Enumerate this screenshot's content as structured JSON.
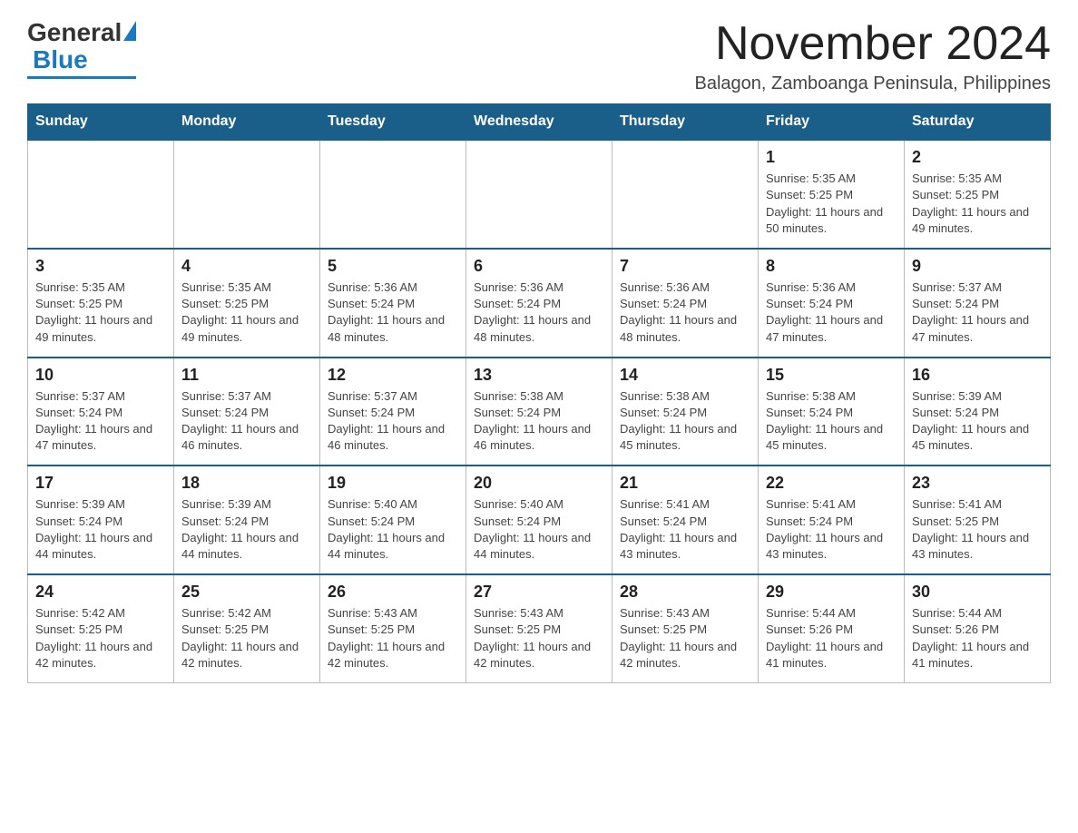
{
  "logo": {
    "general": "General",
    "blue": "Blue"
  },
  "header": {
    "month_year": "November 2024",
    "location": "Balagon, Zamboanga Peninsula, Philippines"
  },
  "days_of_week": [
    "Sunday",
    "Monday",
    "Tuesday",
    "Wednesday",
    "Thursday",
    "Friday",
    "Saturday"
  ],
  "weeks": [
    [
      {
        "day": "",
        "info": ""
      },
      {
        "day": "",
        "info": ""
      },
      {
        "day": "",
        "info": ""
      },
      {
        "day": "",
        "info": ""
      },
      {
        "day": "",
        "info": ""
      },
      {
        "day": "1",
        "info": "Sunrise: 5:35 AM\nSunset: 5:25 PM\nDaylight: 11 hours and 50 minutes."
      },
      {
        "day": "2",
        "info": "Sunrise: 5:35 AM\nSunset: 5:25 PM\nDaylight: 11 hours and 49 minutes."
      }
    ],
    [
      {
        "day": "3",
        "info": "Sunrise: 5:35 AM\nSunset: 5:25 PM\nDaylight: 11 hours and 49 minutes."
      },
      {
        "day": "4",
        "info": "Sunrise: 5:35 AM\nSunset: 5:25 PM\nDaylight: 11 hours and 49 minutes."
      },
      {
        "day": "5",
        "info": "Sunrise: 5:36 AM\nSunset: 5:24 PM\nDaylight: 11 hours and 48 minutes."
      },
      {
        "day": "6",
        "info": "Sunrise: 5:36 AM\nSunset: 5:24 PM\nDaylight: 11 hours and 48 minutes."
      },
      {
        "day": "7",
        "info": "Sunrise: 5:36 AM\nSunset: 5:24 PM\nDaylight: 11 hours and 48 minutes."
      },
      {
        "day": "8",
        "info": "Sunrise: 5:36 AM\nSunset: 5:24 PM\nDaylight: 11 hours and 47 minutes."
      },
      {
        "day": "9",
        "info": "Sunrise: 5:37 AM\nSunset: 5:24 PM\nDaylight: 11 hours and 47 minutes."
      }
    ],
    [
      {
        "day": "10",
        "info": "Sunrise: 5:37 AM\nSunset: 5:24 PM\nDaylight: 11 hours and 47 minutes."
      },
      {
        "day": "11",
        "info": "Sunrise: 5:37 AM\nSunset: 5:24 PM\nDaylight: 11 hours and 46 minutes."
      },
      {
        "day": "12",
        "info": "Sunrise: 5:37 AM\nSunset: 5:24 PM\nDaylight: 11 hours and 46 minutes."
      },
      {
        "day": "13",
        "info": "Sunrise: 5:38 AM\nSunset: 5:24 PM\nDaylight: 11 hours and 46 minutes."
      },
      {
        "day": "14",
        "info": "Sunrise: 5:38 AM\nSunset: 5:24 PM\nDaylight: 11 hours and 45 minutes."
      },
      {
        "day": "15",
        "info": "Sunrise: 5:38 AM\nSunset: 5:24 PM\nDaylight: 11 hours and 45 minutes."
      },
      {
        "day": "16",
        "info": "Sunrise: 5:39 AM\nSunset: 5:24 PM\nDaylight: 11 hours and 45 minutes."
      }
    ],
    [
      {
        "day": "17",
        "info": "Sunrise: 5:39 AM\nSunset: 5:24 PM\nDaylight: 11 hours and 44 minutes."
      },
      {
        "day": "18",
        "info": "Sunrise: 5:39 AM\nSunset: 5:24 PM\nDaylight: 11 hours and 44 minutes."
      },
      {
        "day": "19",
        "info": "Sunrise: 5:40 AM\nSunset: 5:24 PM\nDaylight: 11 hours and 44 minutes."
      },
      {
        "day": "20",
        "info": "Sunrise: 5:40 AM\nSunset: 5:24 PM\nDaylight: 11 hours and 44 minutes."
      },
      {
        "day": "21",
        "info": "Sunrise: 5:41 AM\nSunset: 5:24 PM\nDaylight: 11 hours and 43 minutes."
      },
      {
        "day": "22",
        "info": "Sunrise: 5:41 AM\nSunset: 5:24 PM\nDaylight: 11 hours and 43 minutes."
      },
      {
        "day": "23",
        "info": "Sunrise: 5:41 AM\nSunset: 5:25 PM\nDaylight: 11 hours and 43 minutes."
      }
    ],
    [
      {
        "day": "24",
        "info": "Sunrise: 5:42 AM\nSunset: 5:25 PM\nDaylight: 11 hours and 42 minutes."
      },
      {
        "day": "25",
        "info": "Sunrise: 5:42 AM\nSunset: 5:25 PM\nDaylight: 11 hours and 42 minutes."
      },
      {
        "day": "26",
        "info": "Sunrise: 5:43 AM\nSunset: 5:25 PM\nDaylight: 11 hours and 42 minutes."
      },
      {
        "day": "27",
        "info": "Sunrise: 5:43 AM\nSunset: 5:25 PM\nDaylight: 11 hours and 42 minutes."
      },
      {
        "day": "28",
        "info": "Sunrise: 5:43 AM\nSunset: 5:25 PM\nDaylight: 11 hours and 42 minutes."
      },
      {
        "day": "29",
        "info": "Sunrise: 5:44 AM\nSunset: 5:26 PM\nDaylight: 11 hours and 41 minutes."
      },
      {
        "day": "30",
        "info": "Sunrise: 5:44 AM\nSunset: 5:26 PM\nDaylight: 11 hours and 41 minutes."
      }
    ]
  ]
}
